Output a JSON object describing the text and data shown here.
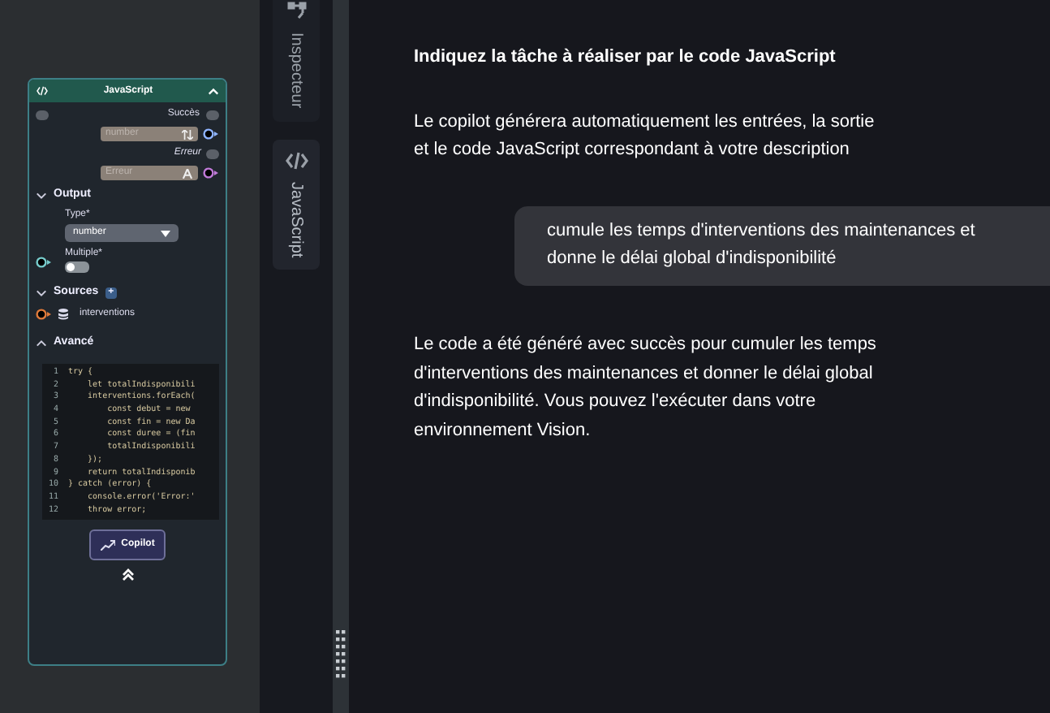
{
  "node": {
    "title": "JavaScript",
    "expanded": true,
    "success_label": "Succès",
    "input_field": {
      "placeholder": "number"
    },
    "error_label": "Erreur",
    "error_field": {
      "placeholder": "Erreur"
    },
    "output": {
      "title": "Output",
      "expanded": true,
      "type_label": "Type*",
      "type_value": "number",
      "multiple_label": "Multiple*",
      "multiple_on": false
    },
    "sources": {
      "title": "Sources",
      "expanded": true,
      "add": "+",
      "items": [
        {
          "label": "interventions"
        }
      ]
    },
    "advanced": {
      "title": "Avancé",
      "expanded": true
    },
    "code_lines": [
      {
        "number": "1",
        "text": "try {"
      },
      {
        "number": "2",
        "text": "    let totalIndisponibili"
      },
      {
        "number": "3",
        "text": "    interventions.forEach("
      },
      {
        "number": "4",
        "text": "        const debut = new "
      },
      {
        "number": "5",
        "text": "        const fin = new Da"
      },
      {
        "number": "6",
        "text": "        const duree = (fin"
      },
      {
        "number": "7",
        "text": "        totalIndisponibili"
      },
      {
        "number": "8",
        "text": "    });"
      },
      {
        "number": "9",
        "text": "    return totalIndisponib"
      },
      {
        "number": "10",
        "text": "} catch (error) {"
      },
      {
        "number": "11",
        "text": "    console.error('Error:'"
      },
      {
        "number": "12",
        "text": "    throw error;"
      }
    ],
    "copilot_button": "Copilot"
  },
  "side_tabs": [
    {
      "label": "Inspecteur",
      "kind": "tree",
      "selected": false
    },
    {
      "label": "JavaScript",
      "kind": "code",
      "selected": true
    }
  ],
  "chat": {
    "heading": "Indiquez la tâche à réaliser par le code JavaScript",
    "intro": "Le copilot générera automatiquement les entrées, la sortie et le code JavaScript correspondant à votre description",
    "messages": [
      {
        "kind": "bubble",
        "text": "cumule les temps d'interventions des maintenances et donne le délai global d'indisponibilité"
      },
      {
        "kind": "plain",
        "text": "Le code a été généré avec succès pour cumuler les temps d'interventions des maintenances et donner le délai global d'indisponibilité. Vous pouvez l'exécuter dans votre environnement Vision."
      }
    ]
  }
}
